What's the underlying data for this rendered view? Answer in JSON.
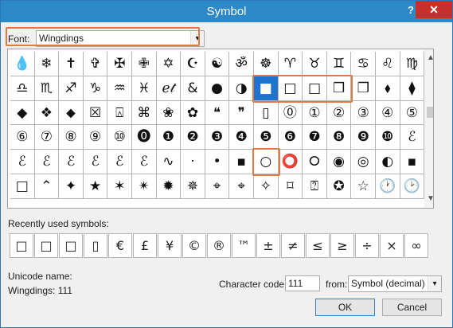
{
  "window": {
    "title": "Symbol",
    "help_label": "?",
    "close_label": "✕"
  },
  "font": {
    "label": "Font:",
    "value": "Wingdings",
    "arrow": "▾"
  },
  "grid": {
    "rows": [
      [
        "💧",
        "❄",
        "✝",
        "✞",
        "✠",
        "✙",
        "✡",
        "☪",
        "☯",
        "ॐ",
        "☸",
        "♈",
        "♉",
        "♊",
        "♋",
        "♌",
        "♍"
      ],
      [
        "♎",
        "♏",
        "♐",
        "♑",
        "♒",
        "♓",
        "ℯ𝓉",
        "&",
        "●",
        "◑",
        "■",
        "□",
        "□",
        "❒",
        "❐",
        "⬧",
        "⧫"
      ],
      [
        "◆",
        "❖",
        "⬥",
        "☒",
        "⍓",
        "⌘",
        "❀",
        "✿",
        "❝",
        "❞",
        "▯",
        "⓪",
        "①",
        "②",
        "③",
        "④",
        "⑤"
      ],
      [
        "⑥",
        "⑦",
        "⑧",
        "⑨",
        "⑩",
        "⓿",
        "❶",
        "❷",
        "❸",
        "❹",
        "❺",
        "❻",
        "❼",
        "❽",
        "❾",
        "❿",
        "ℰ"
      ],
      [
        "ℰ",
        "ℰ",
        "ℰ",
        "ℰ",
        "ℰ",
        "ℰ",
        "∿",
        "·",
        "•",
        "▪",
        "○",
        "⭕",
        "⭘",
        "◉",
        "◎",
        "◐",
        "▪"
      ],
      [
        "□",
        "⌃",
        "✦",
        "★",
        "✶",
        "✴",
        "✹",
        "✵",
        "⌖",
        "⌖",
        "✧",
        "⌑",
        "⍰",
        "✪",
        "☆",
        "🕐",
        "🕑"
      ]
    ],
    "selected_symbol": "□",
    "scroll_up": "▲",
    "scroll_down": "▼"
  },
  "recent": {
    "label": "Recently used symbols:",
    "items": [
      "□",
      "□",
      "□",
      "▯",
      "€",
      "£",
      "¥",
      "©",
      "®",
      "™",
      "±",
      "≠",
      "≤",
      "≥",
      "÷",
      "×",
      "∞"
    ]
  },
  "unicode": {
    "name_label": "Unicode name:",
    "name_value": "Wingdings: 111"
  },
  "code": {
    "label": "Character code:",
    "value": "111",
    "from_label": "from:",
    "from_value": "Symbol (decimal)",
    "from_arrow": "▾"
  },
  "buttons": {
    "ok": "OK",
    "cancel": "Cancel"
  }
}
